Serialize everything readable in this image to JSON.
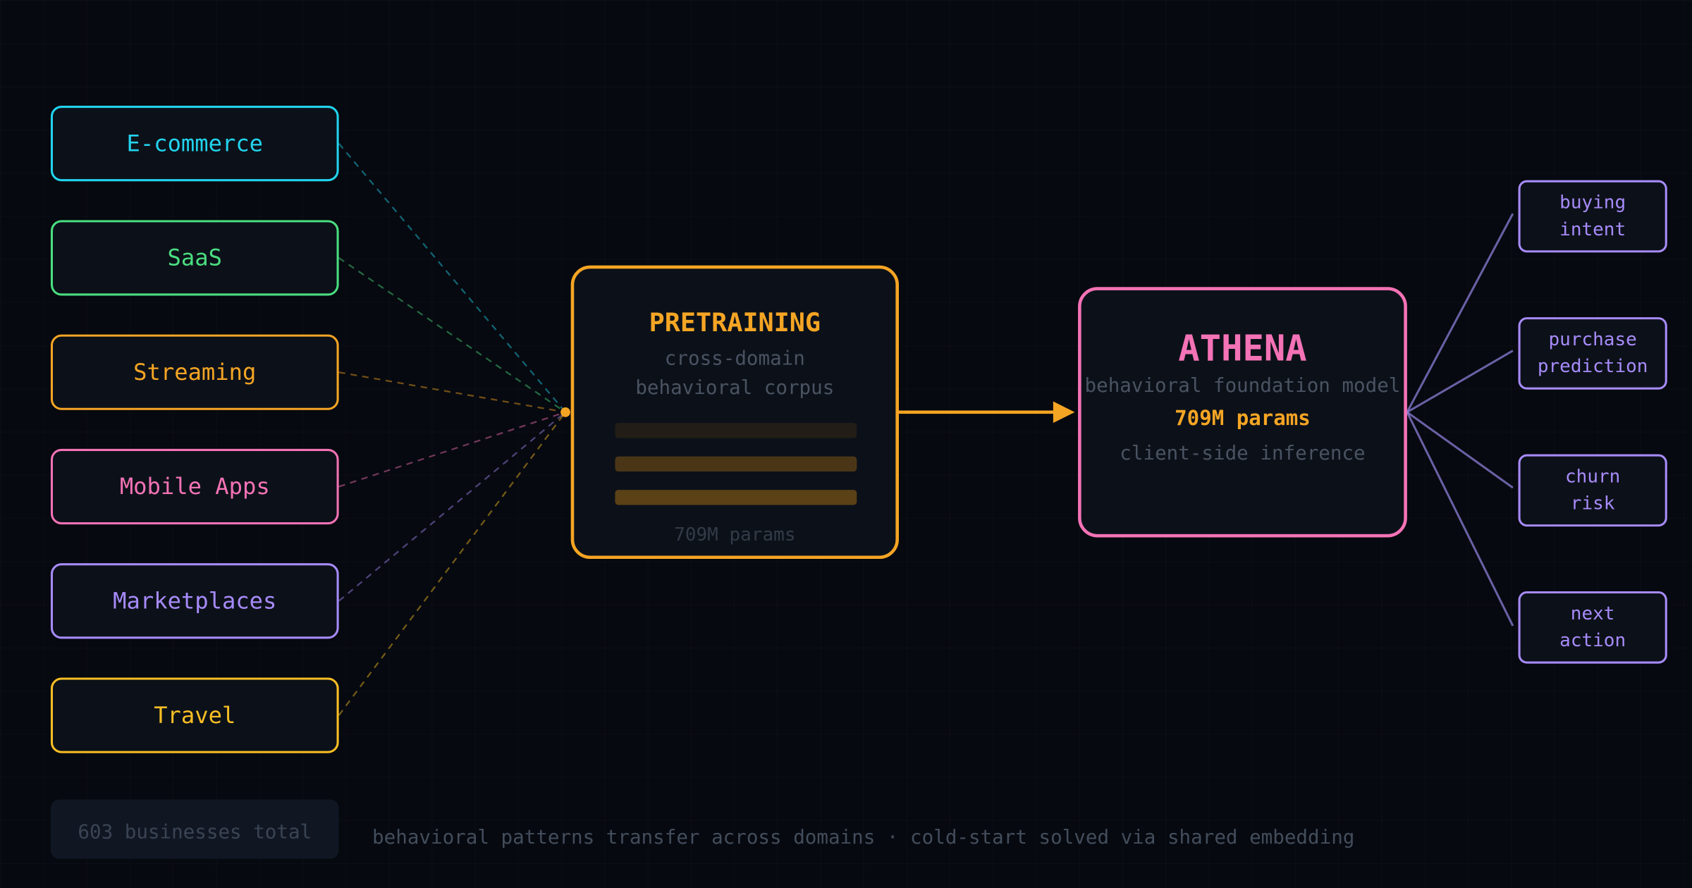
{
  "sources": [
    {
      "label": "E-commerce",
      "color": "#22d3ee"
    },
    {
      "label": "SaaS",
      "color": "#4ade80"
    },
    {
      "label": "Streaming",
      "color": "#f5a524"
    },
    {
      "label": "Mobile Apps",
      "color": "#f472b6"
    },
    {
      "label": "Marketplaces",
      "color": "#a78bfa"
    },
    {
      "label": "Travel",
      "color": "#fbbf24"
    }
  ],
  "total_label": "603 businesses total",
  "caption": "behavioral patterns transfer across domains · cold-start solved via shared embedding",
  "pretraining": {
    "title": "PRETRAINING",
    "subtitle_line1": "cross-domain",
    "subtitle_line2": "behavioral corpus",
    "footer": "709M params",
    "color": "#f5a524"
  },
  "athena": {
    "title": "ATHENA",
    "subtitle": "behavioral foundation model",
    "params": "709M params",
    "inference": "client-side inference",
    "color": "#f472b6"
  },
  "outputs": [
    {
      "line1": "buying",
      "line2": "intent"
    },
    {
      "line1": "purchase",
      "line2": "prediction"
    },
    {
      "line1": "churn",
      "line2": "risk"
    },
    {
      "line1": "next",
      "line2": "action"
    }
  ],
  "output_color": "#a78bfa"
}
